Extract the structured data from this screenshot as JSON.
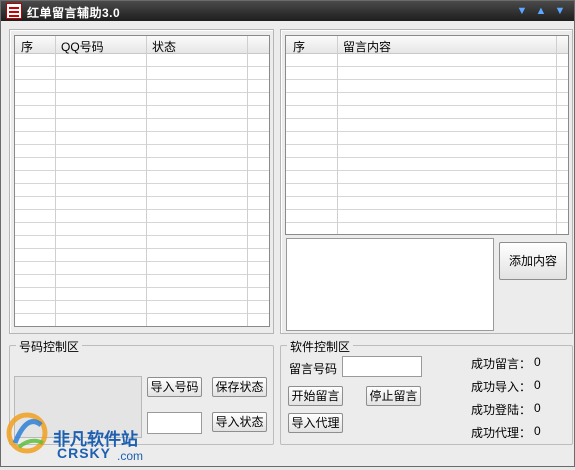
{
  "window": {
    "title": "红单留言辅助3.0"
  },
  "left_list": {
    "columns": [
      "序",
      "QQ号码",
      "状态"
    ]
  },
  "right_list": {
    "columns": [
      "序",
      "留言内容"
    ]
  },
  "add_content_button": "添加内容",
  "number_control": {
    "title": "号码控制区",
    "import_numbers": "导入号码",
    "save_status": "保存状态",
    "import_status": "导入状态"
  },
  "software_control": {
    "title": "软件控制区",
    "message_number_label": "留言号码",
    "start_button": "开始留言",
    "stop_button": "停止留言",
    "import_proxy_button": "导入代理",
    "stats": [
      {
        "label": "成功留言：",
        "value": "0"
      },
      {
        "label": "成功导入：",
        "value": "0"
      },
      {
        "label": "成功登陆：",
        "value": "0"
      },
      {
        "label": "成功代理：",
        "value": "0"
      }
    ]
  },
  "watermark": {
    "brand": "非凡软件站",
    "domain": "CRSKY",
    "suffix": ".com"
  }
}
